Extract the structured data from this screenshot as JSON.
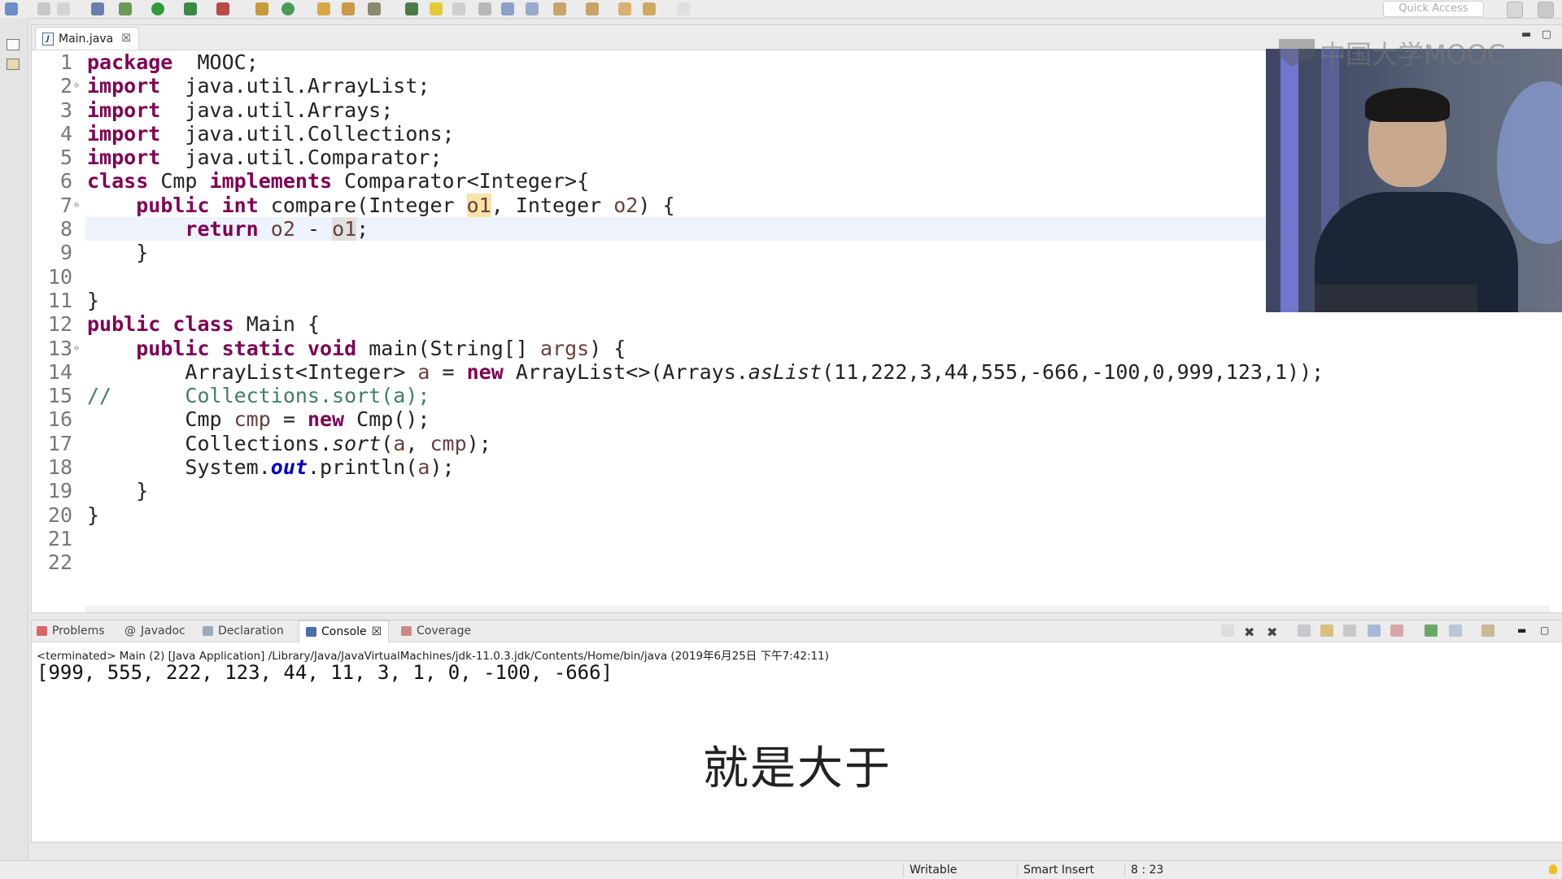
{
  "toolbar": {
    "quick_access_placeholder": "Quick Access"
  },
  "editor": {
    "tab_label": "Main.java",
    "code_lines": [
      {
        "n": "1",
        "html_parts": [
          [
            "kw",
            "package"
          ],
          [
            "",
            "  MOOC;"
          ]
        ]
      },
      {
        "n": "2",
        "fold": "⊖",
        "html_parts": [
          [
            "kw",
            "import"
          ],
          [
            "",
            "  java.util.ArrayList;"
          ]
        ]
      },
      {
        "n": "3",
        "html_parts": [
          [
            "kw",
            "import"
          ],
          [
            "",
            "  java.util.Arrays;"
          ]
        ]
      },
      {
        "n": "4",
        "html_parts": [
          [
            "kw",
            "import"
          ],
          [
            "",
            "  java.util.Collections;"
          ]
        ]
      },
      {
        "n": "5",
        "html_parts": [
          [
            "kw",
            "import"
          ],
          [
            "",
            "  java.util.Comparator;"
          ]
        ]
      },
      {
        "n": "6",
        "html_parts": [
          [
            "kw",
            "class"
          ],
          [
            "",
            " Cmp "
          ],
          [
            "kw",
            "implements"
          ],
          [
            "",
            " Comparator<Integer>{"
          ]
        ]
      },
      {
        "n": "7",
        "fold": "⊖",
        "html_parts": [
          [
            "",
            "    "
          ],
          [
            "kw",
            "public"
          ],
          [
            "",
            " "
          ],
          [
            "kw",
            "int"
          ],
          [
            "",
            " compare(Integer "
          ],
          [
            "var occ",
            "o1"
          ],
          [
            "",
            ", Integer "
          ],
          [
            "var",
            "o2"
          ],
          [
            "",
            ") {"
          ]
        ]
      },
      {
        "n": "8",
        "current": true,
        "html_parts": [
          [
            "",
            "        "
          ],
          [
            "kw",
            "return"
          ],
          [
            "",
            " "
          ],
          [
            "var",
            "o2"
          ],
          [
            "",
            " - "
          ],
          [
            "var occ2",
            "o1"
          ],
          [
            "",
            ";"
          ]
        ]
      },
      {
        "n": "9",
        "html_parts": [
          [
            "",
            "    }"
          ]
        ]
      },
      {
        "n": "10",
        "html_parts": [
          [
            "",
            ""
          ]
        ]
      },
      {
        "n": "11",
        "html_parts": [
          [
            "",
            "}"
          ]
        ]
      },
      {
        "n": "12",
        "html_parts": [
          [
            "kw",
            "public"
          ],
          [
            "",
            " "
          ],
          [
            "kw",
            "class"
          ],
          [
            "",
            " Main {"
          ]
        ]
      },
      {
        "n": "13",
        "fold": "⊖",
        "html_parts": [
          [
            "",
            "    "
          ],
          [
            "kw",
            "public"
          ],
          [
            "",
            " "
          ],
          [
            "kw",
            "static"
          ],
          [
            "",
            " "
          ],
          [
            "kw",
            "void"
          ],
          [
            "",
            " main(String[] "
          ],
          [
            "var",
            "args"
          ],
          [
            "",
            ") {"
          ]
        ]
      },
      {
        "n": "14",
        "html_parts": [
          [
            "",
            "        ArrayList<Integer> "
          ],
          [
            "var",
            "a"
          ],
          [
            "",
            " = "
          ],
          [
            "kw",
            "new"
          ],
          [
            "",
            " ArrayList<>(Arrays."
          ],
          [
            "st",
            "asList"
          ],
          [
            "",
            "(11,222,3,44,555,-666,-100,0,999,123,1));"
          ]
        ]
      },
      {
        "n": "15",
        "html_parts": [
          [
            "cm",
            "//      Collections.sort(a);"
          ]
        ]
      },
      {
        "n": "16",
        "html_parts": [
          [
            "",
            "        Cmp "
          ],
          [
            "var",
            "cmp"
          ],
          [
            "",
            " = "
          ],
          [
            "kw",
            "new"
          ],
          [
            "",
            " Cmp();"
          ]
        ]
      },
      {
        "n": "17",
        "html_parts": [
          [
            "",
            "        Collections."
          ],
          [
            "st",
            "sort"
          ],
          [
            "",
            "("
          ],
          [
            "var",
            "a"
          ],
          [
            "",
            ", "
          ],
          [
            "var",
            "cmp"
          ],
          [
            "",
            ");"
          ]
        ]
      },
      {
        "n": "18",
        "html_parts": [
          [
            "",
            "        System."
          ],
          [
            "fld",
            "out"
          ],
          [
            "",
            ".println("
          ],
          [
            "var",
            "a"
          ],
          [
            "",
            ");"
          ]
        ]
      },
      {
        "n": "19",
        "html_parts": [
          [
            "",
            "    }"
          ]
        ]
      },
      {
        "n": "20",
        "html_parts": [
          [
            "",
            "}"
          ]
        ]
      },
      {
        "n": "21",
        "html_parts": [
          [
            "",
            ""
          ]
        ]
      },
      {
        "n": "22",
        "html_parts": [
          [
            "",
            ""
          ]
        ]
      }
    ]
  },
  "watermark": {
    "text": "中国大学MOOC"
  },
  "console": {
    "tabs": [
      "Problems",
      "Javadoc",
      "Declaration",
      "Console",
      "Coverage"
    ],
    "active_tab": "Console",
    "terminated_line": "<terminated> Main (2) [Java Application] /Library/Java/JavaVirtualMachines/jdk-11.0.3.jdk/Contents/Home/bin/java (2019年6月25日 下午7:42:11)",
    "output": "[999, 555, 222, 123, 44, 11, 3, 1, 0, -100, -666]"
  },
  "subtitle": "就是大于",
  "statusbar": {
    "mode": "Writable",
    "insert": "Smart Insert",
    "position": "8 : 23"
  },
  "colors": {
    "keyword": "#7f0055",
    "comment": "#3f7f5f",
    "local_var": "#6a3e3e",
    "field": "#0000c0",
    "current_line": "#eef3fb",
    "occurrence": "#f7e4a9"
  }
}
